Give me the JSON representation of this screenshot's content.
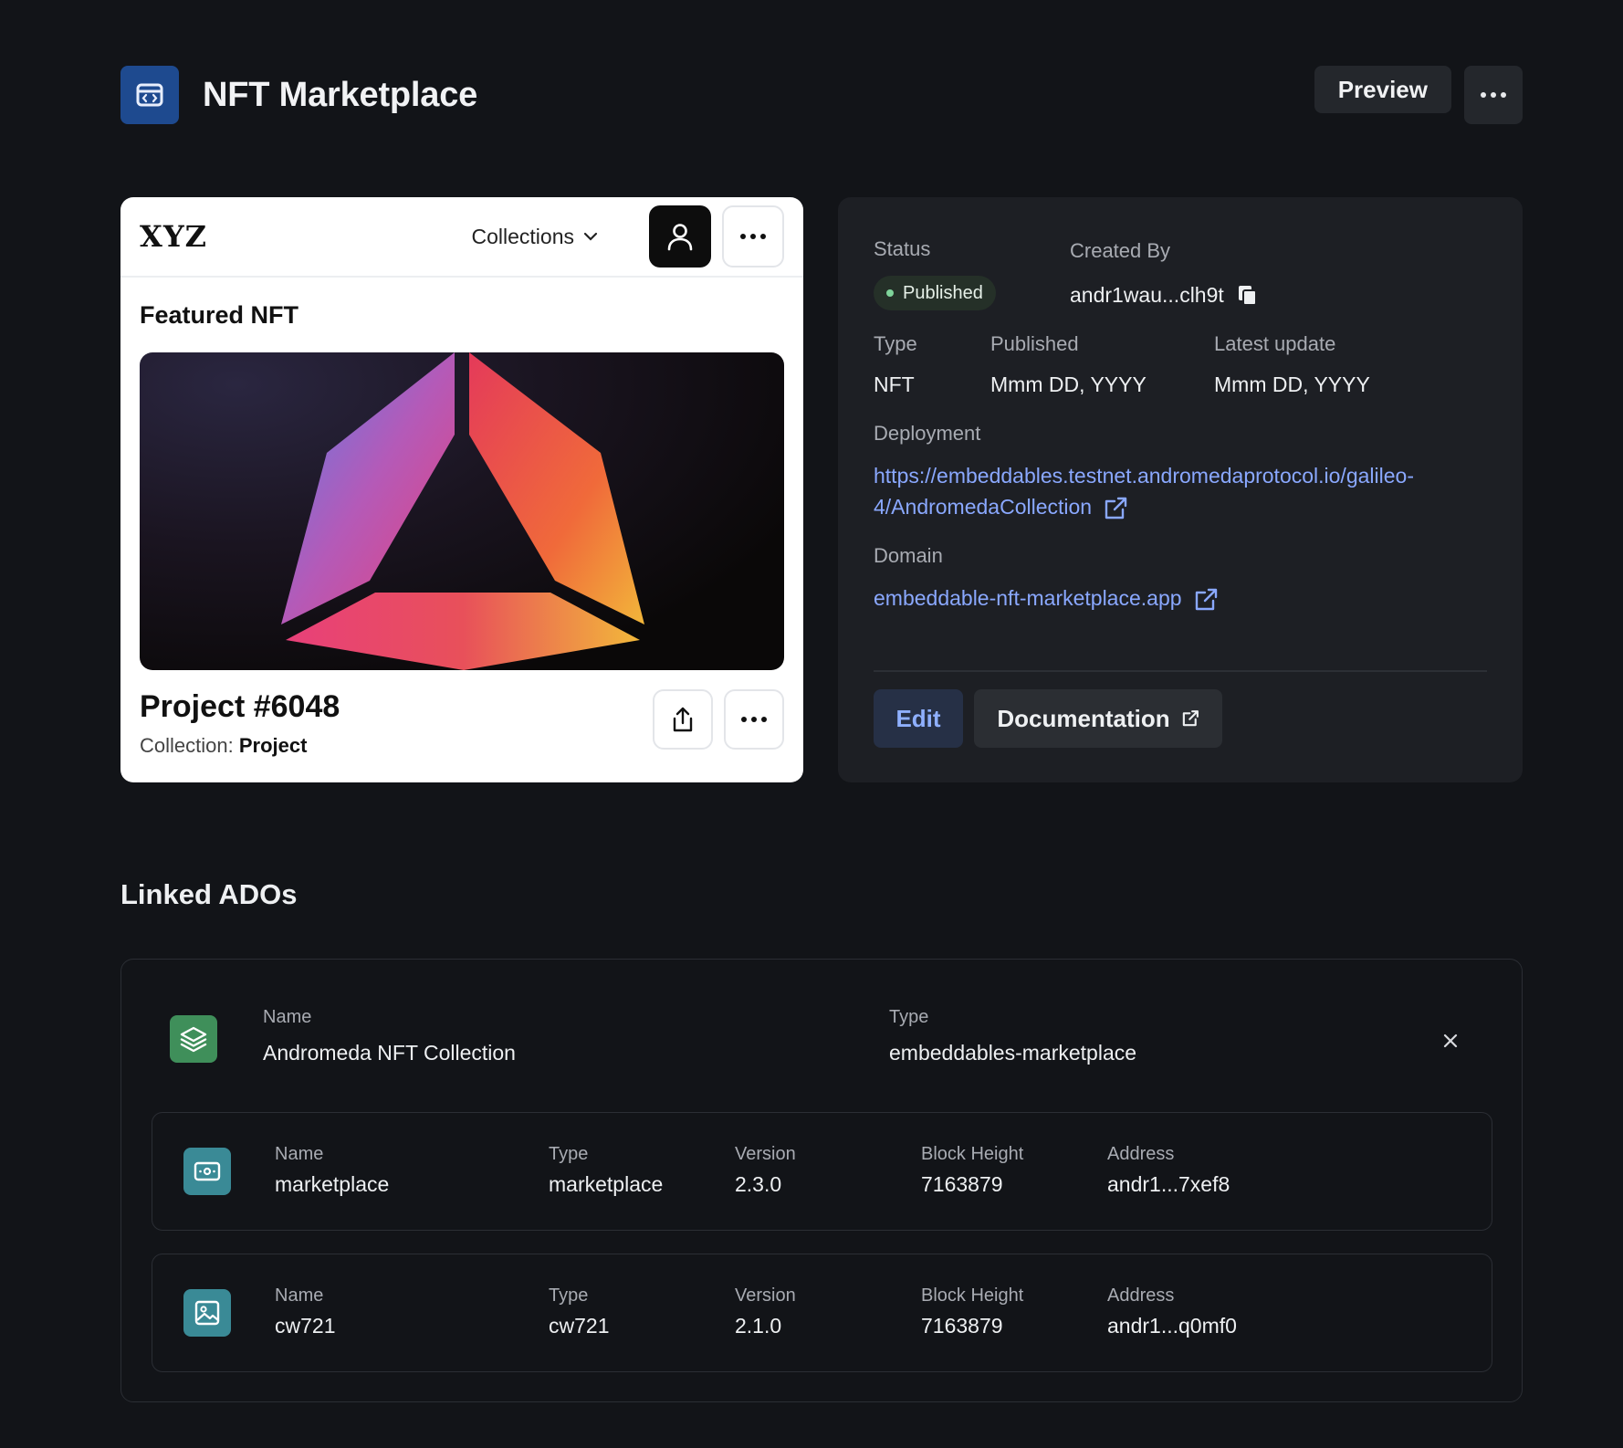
{
  "header": {
    "title": "NFT Marketplace",
    "preview_label": "Preview",
    "more_icon": "more-horizontal-icon",
    "app_icon": "app-code-icon"
  },
  "preview_card": {
    "logo": "XYZ",
    "collections_label": "Collections",
    "featured_label": "Featured NFT",
    "nft_name": "Project #6048",
    "collection_prefix": "Collection:",
    "collection_name": "Project"
  },
  "info": {
    "status_label": "Status",
    "status_value": "Published",
    "created_by_label": "Created By",
    "created_by_value": "andr1wau...clh9t",
    "type_label": "Type",
    "type_value": "NFT",
    "published_label": "Published",
    "published_value": "Mmm DD, YYYY",
    "latest_update_label": "Latest update",
    "latest_update_value": "Mmm DD, YYYY",
    "deployment_label": "Deployment",
    "deployment_line1": "https://embeddables.testnet.andromedaprotocol.io/galileo-",
    "deployment_line2": "4/AndromedaCollection",
    "domain_label": "Domain",
    "domain_value": "embeddable-nft-marketplace.app",
    "edit_label": "Edit",
    "documentation_label": "Documentation"
  },
  "linked": {
    "title": "Linked ADOs",
    "parent": {
      "name_label": "Name",
      "name": "Andromeda NFT Collection",
      "type_label": "Type",
      "type": "embeddables-marketplace"
    },
    "children": [
      {
        "name_label": "Name",
        "name": "marketplace",
        "type_label": "Type",
        "type": "marketplace",
        "version_label": "Version",
        "version": "2.3.0",
        "block_label": "Block Height",
        "block": "7163879",
        "address_label": "Address",
        "address": "andr1...7xef8"
      },
      {
        "name_label": "Name",
        "name": "cw721",
        "type_label": "Type",
        "type": "cw721",
        "version_label": "Version",
        "version": "2.1.0",
        "block_label": "Block Height",
        "block": "7163879",
        "address_label": "Address",
        "address": "andr1...q0mf0"
      }
    ]
  },
  "colors": {
    "background": "#121418",
    "panel": "#1d1f24",
    "accent_link": "#8aa8ff",
    "status_green": "#7fd49a",
    "app_icon_bg": "#1e4a8f",
    "ado_green": "#3f8f5a",
    "ado_teal": "#3a8a96"
  }
}
